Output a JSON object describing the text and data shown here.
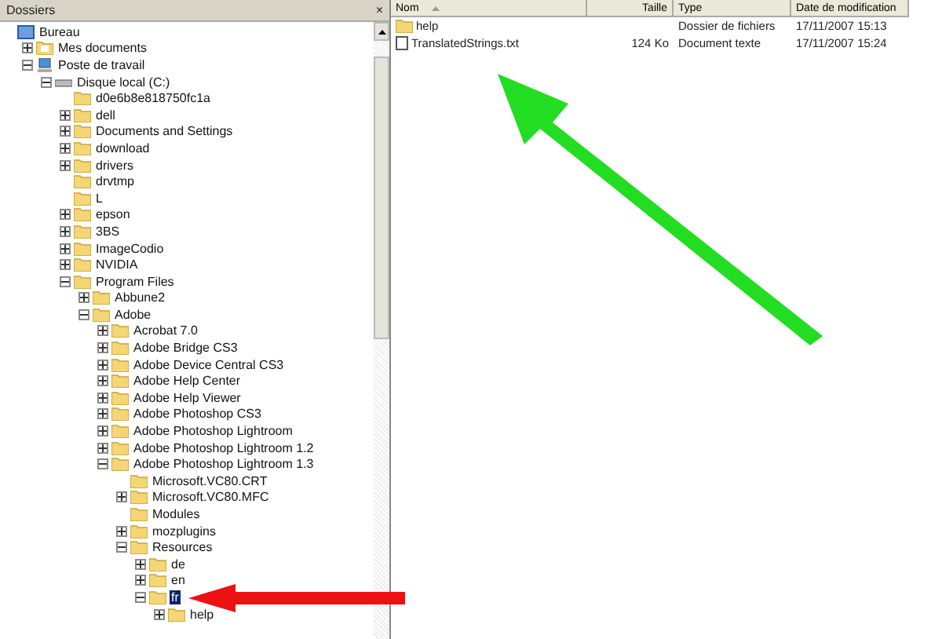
{
  "folders_pane": {
    "title": "Dossiers",
    "close": "×",
    "tree": [
      {
        "label": "Bureau",
        "kind": "desktop",
        "selected": false,
        "children": [
          {
            "label": "Mes documents",
            "kind": "documents",
            "expanded": false,
            "selected": false
          },
          {
            "label": "Poste de travail",
            "kind": "computer",
            "expanded": true,
            "selected": false,
            "children": [
              {
                "label": "Disque local (C:)",
                "kind": "drive",
                "expanded": true,
                "selected": false,
                "children": [
                  {
                    "label": "d0e6b8e818750fc1a",
                    "kind": "folder",
                    "selected": false
                  },
                  {
                    "label": "dell",
                    "kind": "folder",
                    "expanded": false,
                    "selected": false
                  },
                  {
                    "label": "Documents and Settings",
                    "kind": "folder",
                    "expanded": false,
                    "selected": false
                  },
                  {
                    "label": "download",
                    "kind": "folder",
                    "expanded": false,
                    "selected": false
                  },
                  {
                    "label": "drivers",
                    "kind": "folder",
                    "expanded": false,
                    "selected": false
                  },
                  {
                    "label": "drvtmp",
                    "kind": "folder",
                    "selected": false
                  },
                  {
                    "label": "L",
                    "kind": "folder",
                    "selected": false
                  },
                  {
                    "label": "epson",
                    "kind": "folder",
                    "expanded": false,
                    "selected": false
                  },
                  {
                    "label": "3BS",
                    "kind": "folder",
                    "expanded": false,
                    "selected": false
                  },
                  {
                    "label": "ImageCodio",
                    "kind": "folder",
                    "expanded": false,
                    "selected": false
                  },
                  {
                    "label": "NVIDIA",
                    "kind": "folder",
                    "expanded": false,
                    "selected": false
                  },
                  {
                    "label": "Program Files",
                    "kind": "folder",
                    "expanded": true,
                    "selected": false,
                    "children": [
                      {
                        "label": "Abbune2",
                        "kind": "folder",
                        "expanded": false,
                        "selected": false
                      },
                      {
                        "label": "Adobe",
                        "kind": "folder",
                        "expanded": true,
                        "selected": false,
                        "children": [
                          {
                            "label": "Acrobat 7.0",
                            "kind": "folder",
                            "expanded": false,
                            "selected": false
                          },
                          {
                            "label": "Adobe Bridge CS3",
                            "kind": "folder",
                            "expanded": false,
                            "selected": false
                          },
                          {
                            "label": "Adobe Device Central CS3",
                            "kind": "folder",
                            "expanded": false,
                            "selected": false
                          },
                          {
                            "label": "Adobe Help Center",
                            "kind": "folder",
                            "expanded": false,
                            "selected": false
                          },
                          {
                            "label": "Adobe Help Viewer",
                            "kind": "folder",
                            "expanded": false,
                            "selected": false
                          },
                          {
                            "label": "Adobe Photoshop CS3",
                            "kind": "folder",
                            "expanded": false,
                            "selected": false
                          },
                          {
                            "label": "Adobe Photoshop Lightroom",
                            "kind": "folder",
                            "expanded": false,
                            "selected": false
                          },
                          {
                            "label": "Adobe Photoshop Lightroom 1.2",
                            "kind": "folder",
                            "expanded": false,
                            "selected": false
                          },
                          {
                            "label": "Adobe Photoshop Lightroom 1.3",
                            "kind": "folder",
                            "expanded": true,
                            "selected": false,
                            "children": [
                              {
                                "label": "Microsoft.VC80.CRT",
                                "kind": "folder",
                                "selected": false
                              },
                              {
                                "label": "Microsoft.VC80.MFC",
                                "kind": "folder",
                                "expanded": false,
                                "selected": false
                              },
                              {
                                "label": "Modules",
                                "kind": "folder",
                                "selected": false
                              },
                              {
                                "label": "mozplugins",
                                "kind": "folder",
                                "expanded": false,
                                "selected": false
                              },
                              {
                                "label": "Resources",
                                "kind": "folder",
                                "expanded": true,
                                "selected": false,
                                "children": [
                                  {
                                    "label": "de",
                                    "kind": "folder",
                                    "expanded": false,
                                    "selected": false
                                  },
                                  {
                                    "label": "en",
                                    "kind": "folder",
                                    "expanded": false,
                                    "selected": false
                                  },
                                  {
                                    "label": "fr",
                                    "kind": "folder",
                                    "expanded": true,
                                    "selected": true,
                                    "children": [
                                      {
                                        "label": "help",
                                        "kind": "folder",
                                        "expanded": false,
                                        "selected": false
                                      }
                                    ]
                                  }
                                ]
                              }
                            ]
                          }
                        ]
                      }
                    ]
                  }
                ]
              }
            ]
          }
        ]
      }
    ]
  },
  "file_list": {
    "columns": [
      "Nom",
      "Taille",
      "Type",
      "Date de modification"
    ],
    "rows": [
      {
        "kind": "folder",
        "name": "help",
        "type": "Dossier de fichiers",
        "date": "17/11/2007 15:13"
      },
      {
        "kind": "document",
        "name": "TranslatedStrings.txt",
        "size": "124 Ko",
        "type": "Document texte",
        "date": "17/11/2007 15:24"
      }
    ]
  },
  "annotations": [
    {
      "kind": "arrow",
      "color": "#22dd22"
    },
    {
      "kind": "arrow",
      "color": "#ee1111"
    }
  ]
}
